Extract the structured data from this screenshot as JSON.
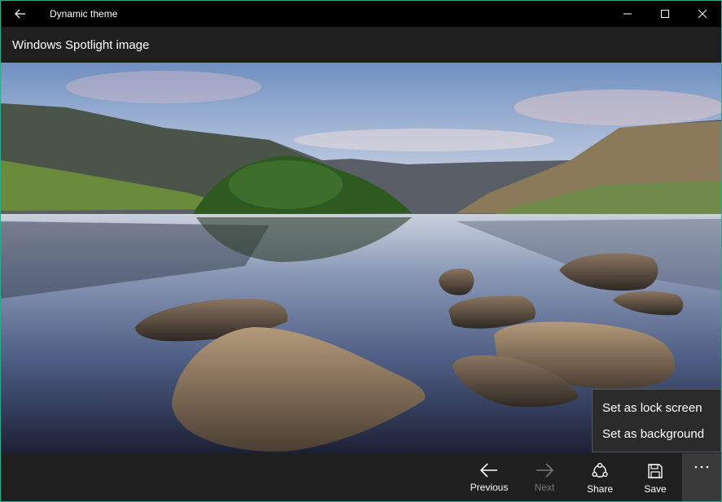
{
  "window": {
    "title": "Dynamic theme"
  },
  "header": {
    "title": "Windows Spotlight image"
  },
  "commandbar": {
    "previous_label": "Previous",
    "next_label": "Next",
    "share_label": "Share",
    "save_label": "Save",
    "more_icon": "ellipsis-icon"
  },
  "flyout": {
    "items": [
      {
        "label": "Set as lock screen"
      },
      {
        "label": "Set as background"
      }
    ]
  },
  "colors": {
    "accent_border": "#2ea98e",
    "titlebar": "#000000",
    "bar": "#1f1f1f",
    "more_active": "#3a3a3a",
    "flyout": "#2b2b2b"
  }
}
